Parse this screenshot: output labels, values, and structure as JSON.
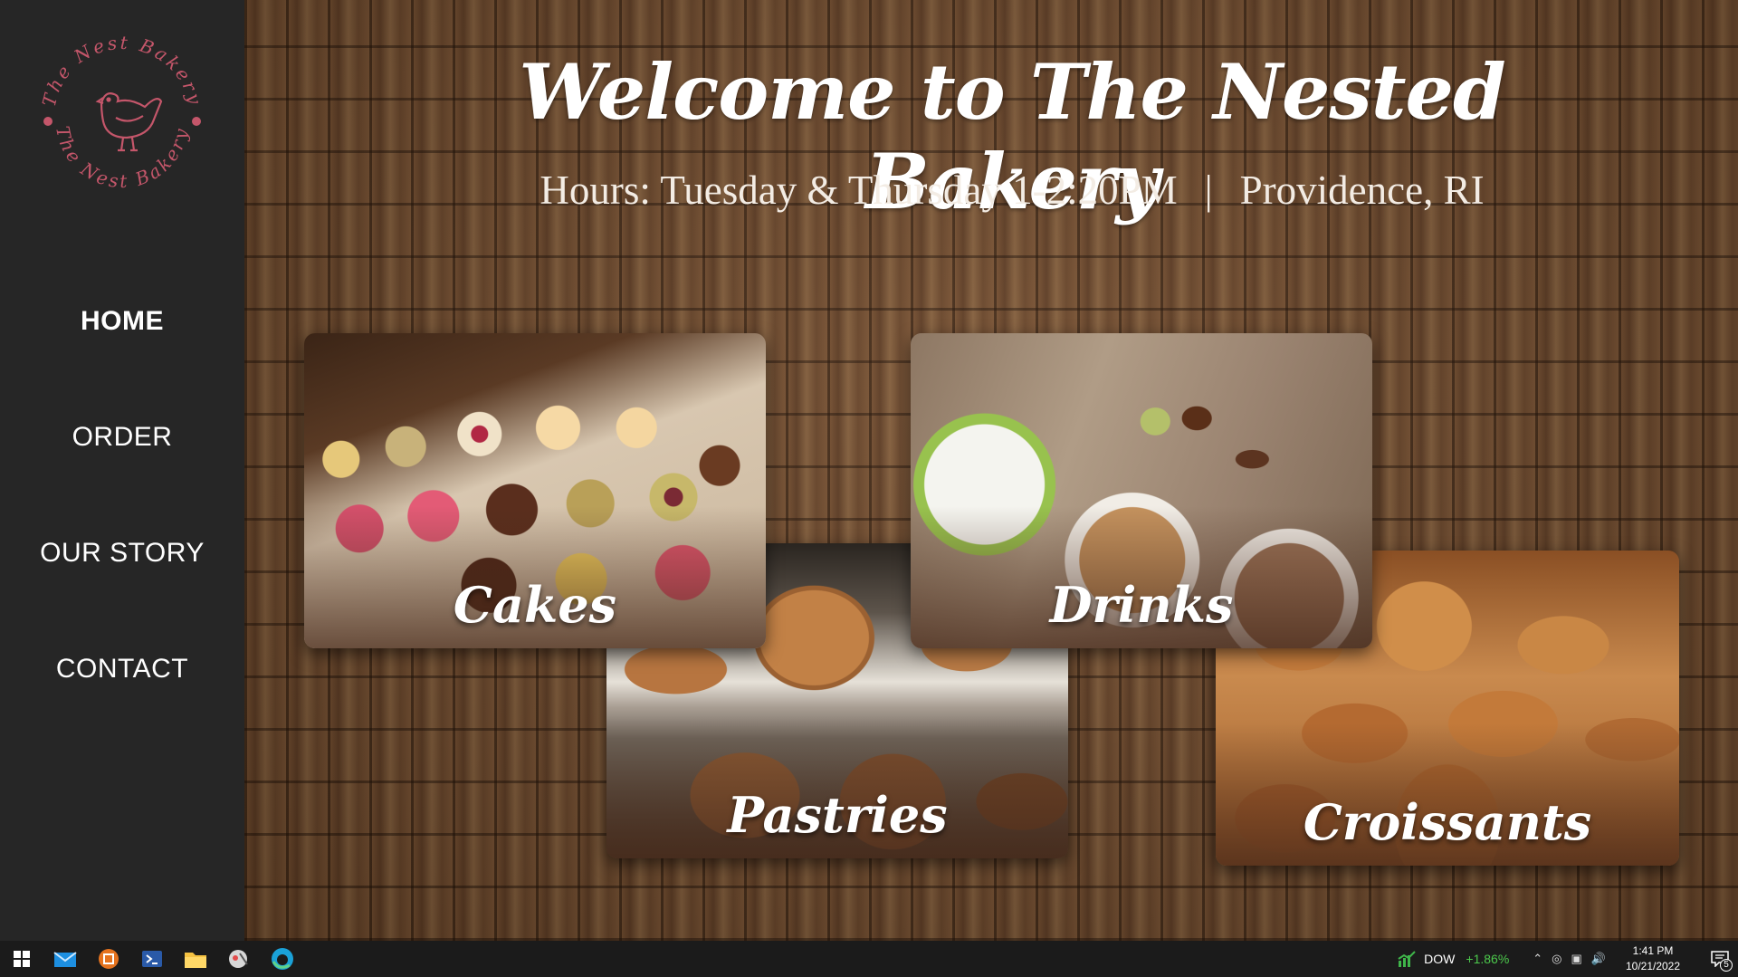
{
  "logo": {
    "ring_text_top": "The Nest Bakery",
    "ring_text_bottom": "The Nest Bakery",
    "color": "#c4566a"
  },
  "nav": {
    "items": [
      {
        "label": "HOME",
        "active": true
      },
      {
        "label": "ORDER",
        "active": false
      },
      {
        "label": "OUR STORY",
        "active": false
      },
      {
        "label": "CONTACT",
        "active": false
      }
    ]
  },
  "hero": {
    "title": "Welcome to The Nested Bakery",
    "hours": "Hours: Tuesday & Thursday 1-2:20PM",
    "separator": "|",
    "location": "Providence, RI"
  },
  "cards": {
    "cakes": "Cakes",
    "drinks": "Drinks",
    "pastries": "Pastries",
    "croissants": "Croissants"
  },
  "taskbar": {
    "ticker_name": "DOW",
    "ticker_change": "+1.86%",
    "time": "1:41 PM",
    "date": "10/21/2022",
    "notification_count": "5"
  },
  "colors": {
    "sidebar_bg": "#262626",
    "accent_logo": "#c4566a",
    "ticker_up": "#4cc94c"
  }
}
